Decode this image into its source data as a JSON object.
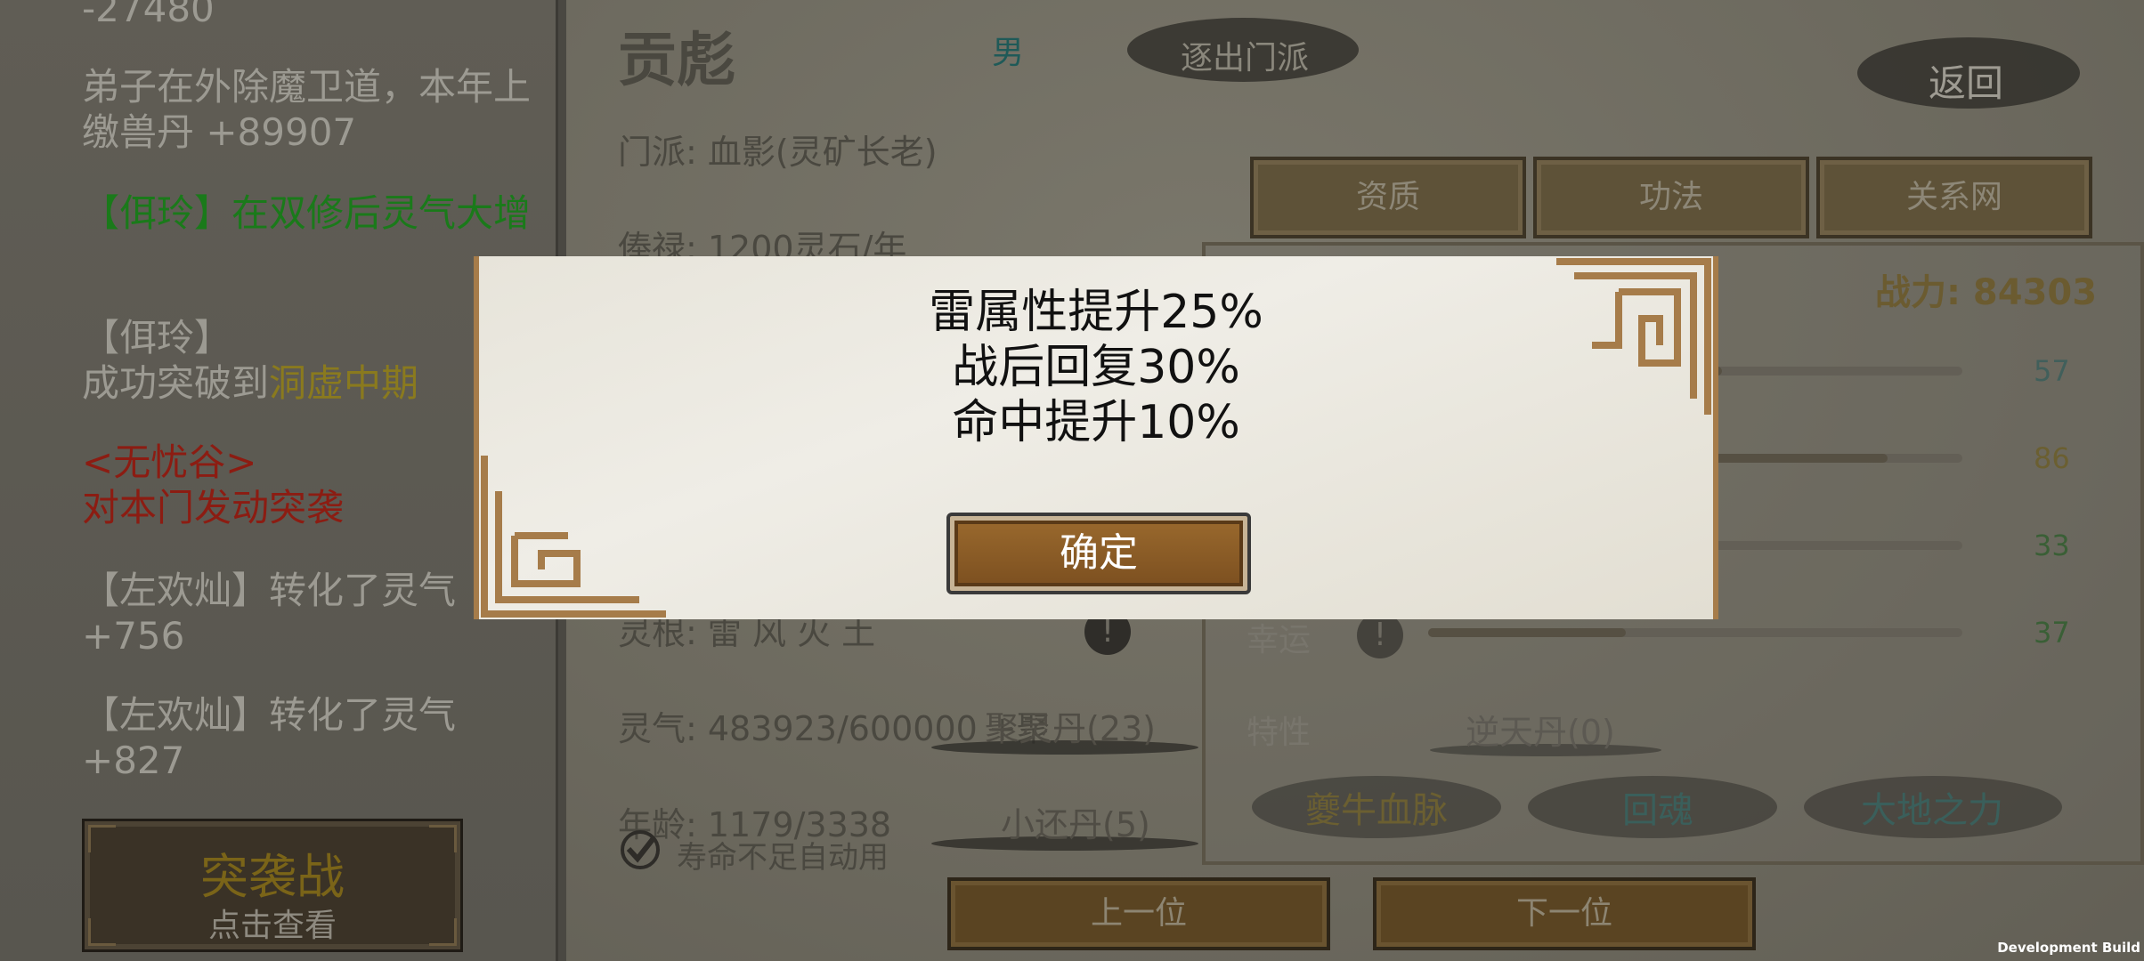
{
  "log": {
    "entries": [
      {
        "text": "-27480"
      },
      {
        "text": "弟子在外除魔卫道，本年上缴兽丹 +89907"
      },
      {
        "text": "【佴玲】在双修后灵气大增"
      },
      {
        "name": "【佴玲】",
        "prefix": "成功突破到",
        "highlight": "洞虚中期"
      },
      {
        "line1": "<无忧谷>",
        "line2": "对本门发动突袭"
      },
      {
        "text": "【左欢灿】转化了灵气",
        "value": "+756"
      },
      {
        "text": "【左欢灿】转化了灵气",
        "value": "+827"
      }
    ],
    "raid_button": {
      "title": "突袭战",
      "subtitle": "点击查看"
    }
  },
  "character": {
    "name": "贡彪",
    "gender": "男",
    "expel_label": "逐出门派",
    "back_label": "返回",
    "sect": "门派: 血影(灵矿长老)",
    "salary": "俸禄: 1200灵石/年",
    "spirit_root": "灵根: 雷 风 火 土",
    "spirit_qi": "灵气: 483923/600000 +聚",
    "pill1": "聚灵丹(23)",
    "age": "年龄: 1179/3338",
    "pill2": "小还丹(5)",
    "auto_use_label": "寿命不足自动用"
  },
  "tabs": [
    "资质",
    "功法",
    "关系网"
  ],
  "stats": {
    "combat_power": "战力: 84303",
    "values": [
      "57",
      "86",
      "33",
      "37"
    ],
    "fills": [
      0.55,
      0.86,
      0.33,
      0.37
    ],
    "luck_label": "幸运",
    "trait_label": "特性",
    "trait_value": "逆天丹(0)",
    "traits": [
      "夔牛血脉",
      "回魂",
      "大地之力"
    ]
  },
  "nav": {
    "prev": "上一位",
    "next": "下一位"
  },
  "dialog": {
    "lines": [
      "雷属性提升25%",
      "战后回复30%",
      "命中提升10%"
    ],
    "confirm": "确定"
  },
  "footer": {
    "dev_build": "Development Build"
  }
}
